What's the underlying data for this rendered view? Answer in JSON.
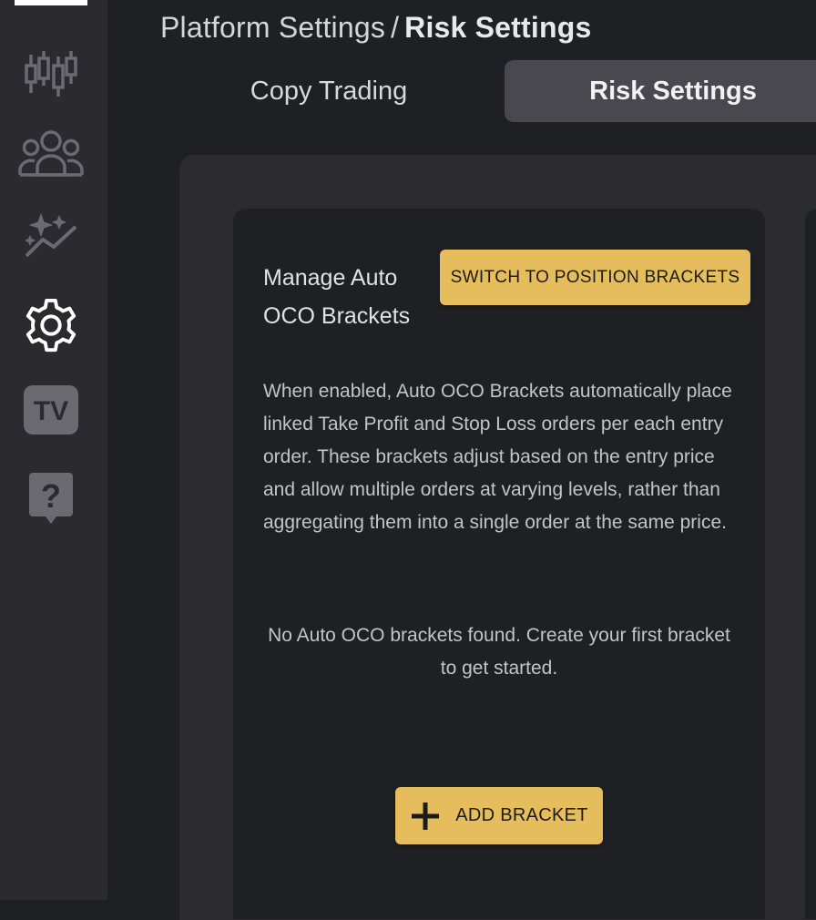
{
  "breadcrumb": {
    "parent": "Platform Settings",
    "separator": "/",
    "current": "Risk Settings"
  },
  "tabs": [
    {
      "label": "Copy Trading",
      "active": false
    },
    {
      "label": "Risk Settings",
      "active": true
    }
  ],
  "sidebar": {
    "items": [
      {
        "icon": "candlestick-chart-icon"
      },
      {
        "icon": "users-group-icon"
      },
      {
        "icon": "sparkle-trend-icon"
      },
      {
        "icon": "gear-icon",
        "active": true
      },
      {
        "icon": "tradingview-icon",
        "label": "TV"
      },
      {
        "icon": "help-icon",
        "label": "?"
      }
    ]
  },
  "card": {
    "title": "Manage Auto OCO Brackets",
    "switch_button": "SWITCH TO POSITION BRACKETS",
    "description": "When enabled, Auto OCO Brackets automatically place linked Take Profit and Stop Loss orders per each entry order. These brackets adjust based on the entry price and allow multiple orders at varying levels, rather than aggregating them into a single order at the same price.",
    "empty_message": "No Auto OCO brackets found. Create your first bracket to get started.",
    "add_button": "ADD BRACKET"
  },
  "colors": {
    "accent": "#e6bd5c",
    "background": "#1f2024",
    "sidebar": "#2a2a2f",
    "active_tab": "#48484e"
  }
}
